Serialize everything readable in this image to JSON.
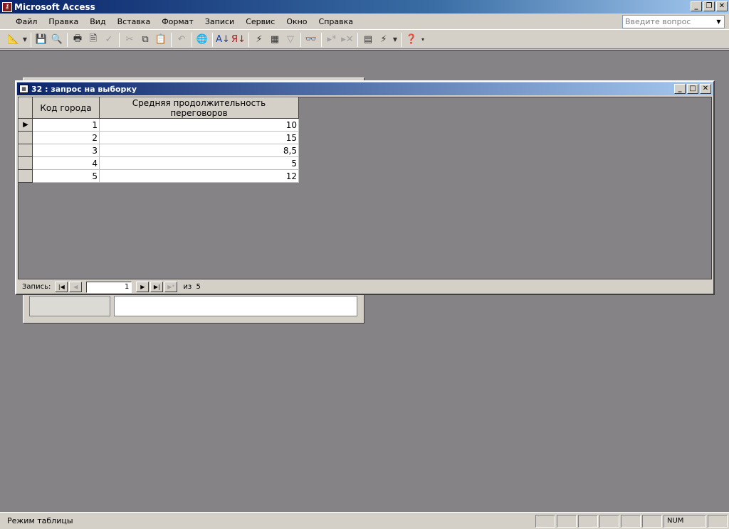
{
  "app": {
    "title": "Microsoft Access"
  },
  "menu": [
    "Файл",
    "Правка",
    "Вид",
    "Вставка",
    "Формат",
    "Записи",
    "Сервис",
    "Окно",
    "Справка"
  ],
  "ask": {
    "placeholder": "Введите вопрос"
  },
  "toolbar": [
    "view-icon",
    "save-icon",
    "file-search-icon",
    "print-icon",
    "print-preview-icon",
    "spelling-icon",
    "cut-icon",
    "copy-icon",
    "paste-icon",
    "undo-icon",
    "hyperlink-icon",
    "sort-asc-icon",
    "sort-desc-icon",
    "filter-by-selection-icon",
    "filter-by-form-icon",
    "apply-filter-icon",
    "find-icon",
    "new-record-icon",
    "delete-record-icon",
    "database-window-icon",
    "new-object-icon",
    "help-icon"
  ],
  "query": {
    "title": "32 : запрос на выборку",
    "columns": [
      "Код города",
      "Средняя продолжительность переговоров"
    ],
    "rows": [
      [
        "1",
        "10"
      ],
      [
        "2",
        "15"
      ],
      [
        "3",
        "8,5"
      ],
      [
        "4",
        "5"
      ],
      [
        "5",
        "12"
      ]
    ]
  },
  "nav": {
    "label": "Запись:",
    "current": "1",
    "of": "из  5"
  },
  "status": {
    "text": "Режим таблицы",
    "num": "NUM"
  }
}
